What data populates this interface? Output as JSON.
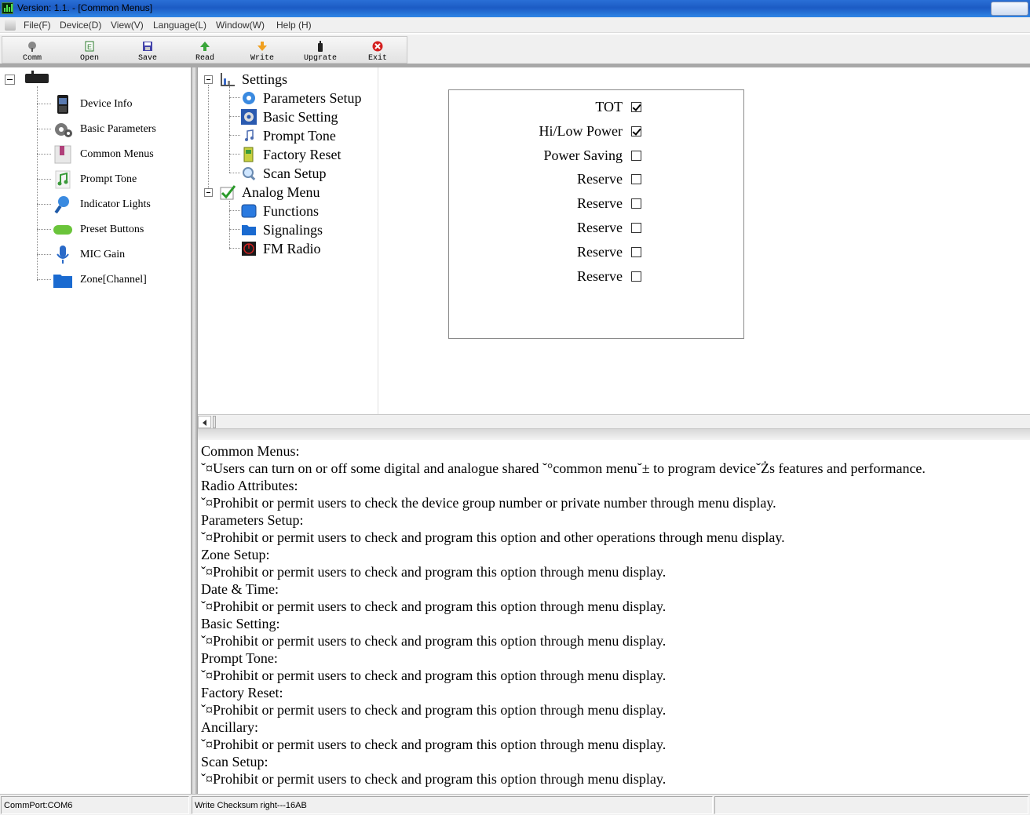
{
  "window": {
    "title": "Version: 1.1. - [Common Menus]"
  },
  "menubar": [
    "File(F)",
    "Device(D)",
    "View(V)",
    "Language(L)",
    "Window(W)",
    "Help (H)"
  ],
  "toolbar": [
    {
      "label": "Comm",
      "icon": "comm-icon"
    },
    {
      "label": "Open",
      "icon": "open-icon"
    },
    {
      "label": "Save",
      "icon": "save-icon"
    },
    {
      "label": "Read",
      "icon": "read-icon"
    },
    {
      "label": "Write",
      "icon": "write-icon"
    },
    {
      "label": "Upgrate",
      "icon": "upgrade-icon"
    },
    {
      "label": "Exit",
      "icon": "exit-icon"
    }
  ],
  "left_tree": {
    "items": [
      {
        "label": "Device Info",
        "icon": "device-info-icon"
      },
      {
        "label": "Basic Parameters",
        "icon": "basic-parameters-icon"
      },
      {
        "label": "Common Menus",
        "icon": "common-menus-icon"
      },
      {
        "label": "Prompt Tone",
        "icon": "prompt-tone-icon"
      },
      {
        "label": "Indicator Lights",
        "icon": "indicator-lights-icon"
      },
      {
        "label": "Preset Buttons",
        "icon": "preset-buttons-icon"
      },
      {
        "label": "MIC Gain",
        "icon": "mic-gain-icon"
      },
      {
        "label": "Zone[Channel]",
        "icon": "zone-channel-icon"
      }
    ]
  },
  "settings_tree": {
    "settings": {
      "label": "Settings",
      "children": [
        "Parameters Setup",
        "Basic Setting",
        "Prompt Tone",
        "Factory Reset",
        "Scan Setup"
      ]
    },
    "analog": {
      "label": "Analog Menu",
      "children": [
        "Functions",
        "Signalings",
        "FM Radio"
      ]
    }
  },
  "options": [
    {
      "label": "TOT",
      "checked": true
    },
    {
      "label": "Hi/Low Power",
      "checked": true
    },
    {
      "label": "Power Saving",
      "checked": false
    },
    {
      "label": "Reserve",
      "checked": false
    },
    {
      "label": "Reserve",
      "checked": false
    },
    {
      "label": "Reserve",
      "checked": false
    },
    {
      "label": "Reserve",
      "checked": false
    },
    {
      "label": "Reserve",
      "checked": false
    }
  ],
  "description": [
    "Common Menus:",
    "ˇ¤Users can turn on or off some digital and analogue shared ˇ°common menuˇ± to program deviceˇŻs features and performance.",
    "Radio Attributes:",
    "ˇ¤Prohibit or permit users to check the device group number or private number through menu display.",
    "Parameters Setup:",
    "ˇ¤Prohibit or permit users to check and program this option and other operations through menu display.",
    "Zone Setup:",
    "ˇ¤Prohibit or permit users to check and program this option through menu display.",
    "Date & Time:",
    "ˇ¤Prohibit or permit users to check and program this option through menu display.",
    "Basic Setting:",
    "ˇ¤Prohibit or permit users to check and program this option through menu display.",
    "Prompt Tone:",
    "ˇ¤Prohibit or permit users to check and program this option through menu display.",
    "Factory Reset:",
    "ˇ¤Prohibit or permit users to check and program this option through menu display.",
    "Ancillary:",
    "ˇ¤Prohibit or permit users to check and program this option through menu display.",
    "Scan Setup:",
    "ˇ¤Prohibit or permit users to check and program this option through menu display."
  ],
  "status": {
    "port": "CommPort:COM6",
    "checksum": "Write Checksum right---16AB",
    "extra": ""
  }
}
